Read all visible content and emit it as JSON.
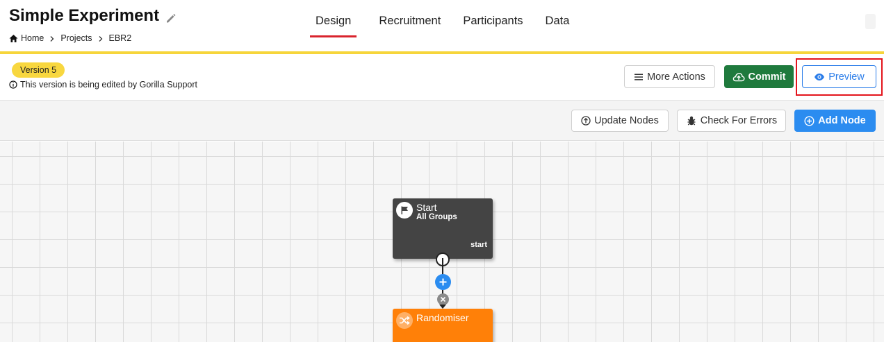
{
  "header": {
    "title": "Simple Experiment",
    "breadcrumb": [
      "Home",
      "Projects",
      "EBR2"
    ],
    "tabs": [
      "Design",
      "Recruitment",
      "Participants",
      "Data"
    ],
    "active_tab": "Design"
  },
  "version": {
    "badge": "Version 5",
    "note": "This version is being edited by Gorilla Support"
  },
  "actions": {
    "more_actions": "More Actions",
    "commit": "Commit",
    "preview": "Preview"
  },
  "toolbar": {
    "update_nodes": "Update Nodes",
    "check_errors": "Check For Errors",
    "add_node": "Add Node"
  },
  "nodes": [
    {
      "title": "Start",
      "subtitle": "All Groups",
      "port": "start",
      "icon": "flag-icon",
      "color": "#444444"
    },
    {
      "title": "Randomiser",
      "icon": "shuffle-icon",
      "color": "#ff8008"
    }
  ],
  "colors": {
    "accent_red": "#d9232d",
    "brand_yellow": "#f6d53b",
    "commit_green": "#1f7a3d",
    "primary_blue": "#2b8cf0"
  }
}
